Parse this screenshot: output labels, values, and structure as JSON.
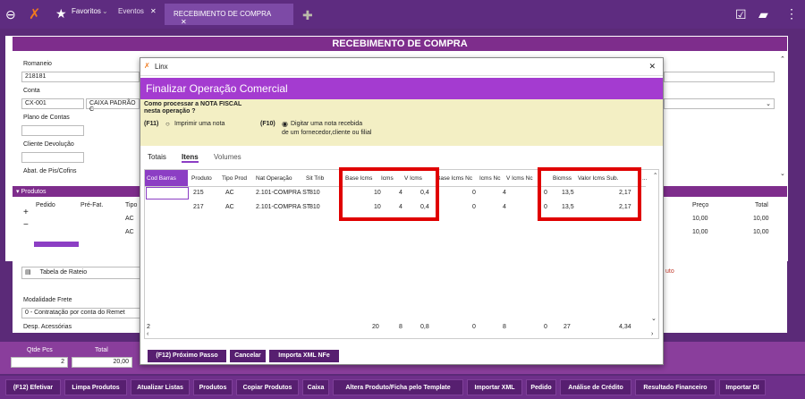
{
  "topbar": {
    "favorites_label": "Favoritos",
    "tabs": [
      {
        "label": "Eventos"
      },
      {
        "label": "RECEBIMENTO DE COMPRA"
      }
    ]
  },
  "page": {
    "title": "RECEBIMENTO DE COMPRA",
    "romaneio": {
      "label": "Romaneio",
      "value": "218181"
    },
    "conta": {
      "label": "Conta",
      "code": "CX-001",
      "name": "CAIXA PADRÃO C"
    },
    "plano_label": "Plano de Contas",
    "cliente_label": "Cliente Devolução",
    "abat_label": "Abat. de Pis/Cofins",
    "produtos": {
      "section_label": "Produtos",
      "headers": [
        "Pedido",
        "Pré-Fat.",
        "Tipo"
      ],
      "rows": [
        [
          "",
          "",
          "AC"
        ],
        [
          "",
          "",
          "AC"
        ]
      ],
      "right_headers": [
        "Preço",
        "Total"
      ],
      "right_rows": [
        [
          "10,00",
          "10,00"
        ],
        [
          "10,00",
          "10,00"
        ]
      ]
    },
    "tabela_rateio_label": "Tabela de Rateio",
    "right_fragment": "uto",
    "modalidade": {
      "label": "Modalidade Frete",
      "value": "0 - Contratação por conta do Remet"
    },
    "desp_label": "Desp. Acessórias",
    "qtde": {
      "label": "Qtde Pcs",
      "value": "2"
    },
    "total": {
      "label": "Total",
      "value": "20,00"
    }
  },
  "dialog": {
    "window_title": "Linx",
    "heading": "Finalizar Operação Comercial",
    "question": "Como processar a NOTA FISCAL nesta operação ?",
    "option1": {
      "key": "(F11)",
      "label": "Imprimir uma nota"
    },
    "option2": {
      "key": "(F10)",
      "line1": "Digitar uma nota recebida",
      "line2": "de um fornecedor,cliente ou filial"
    },
    "tabs": [
      {
        "label": "Totais"
      },
      {
        "label": "Itens"
      },
      {
        "label": "Volumes"
      }
    ],
    "grid_headers": [
      "Cod Barras",
      "Produto",
      "Tipo Prod",
      "Nat Operação",
      "Sit Trib",
      "Base Icms",
      "Icms",
      "V Icms",
      "Base Icms Nc",
      "Icms Nc",
      "V Icms Nc",
      "Bicmss",
      "Valor Icms Sub.",
      "..."
    ],
    "grid_rows": [
      [
        "",
        "215",
        "AC",
        "2.101-COMPRA ST",
        "810",
        "10",
        "4",
        "0,4",
        "0",
        "4",
        "",
        "0",
        "13,5",
        "2,17"
      ],
      [
        "",
        "217",
        "AC",
        "2.101-COMPRA ST",
        "810",
        "10",
        "4",
        "0,4",
        "0",
        "4",
        "",
        "0",
        "13,5",
        "2,17"
      ]
    ],
    "totals_row": [
      "2",
      "",
      "",
      "",
      "",
      "20",
      "8",
      "0,8",
      "0",
      "8",
      "",
      "0",
      "27",
      "4,34"
    ],
    "buttons": [
      {
        "label": "(F12) Próximo Passo"
      },
      {
        "label": "Cancelar"
      },
      {
        "label": "Importa XML NFe"
      }
    ]
  },
  "bottom_buttons": [
    {
      "label": "(F12) Efetivar"
    },
    {
      "label": "Limpa Produtos"
    },
    {
      "label": "Atualizar Listas"
    },
    {
      "label": "Produtos"
    },
    {
      "label": "Copiar Produtos"
    },
    {
      "label": "Caixa"
    },
    {
      "label": "Altera Produto/Ficha pelo Template"
    },
    {
      "label": "Importar XML"
    },
    {
      "label": "Pedido"
    },
    {
      "label": "Análise de Crédito"
    },
    {
      "label": "Resultado Financeiro"
    },
    {
      "label": "Importar DI"
    }
  ]
}
